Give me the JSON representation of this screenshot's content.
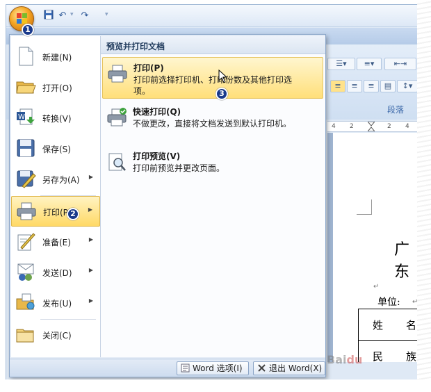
{
  "qat": {
    "undo_glyph": "↶",
    "redo_glyph": "↷",
    "more_glyph": "▾"
  },
  "ribbon": {
    "paragraph_group": "段落",
    "ruler_ticks": [
      "4",
      "2",
      "2",
      "4"
    ]
  },
  "document": {
    "title_fragment": "广东",
    "unit_label": "单位:",
    "table_cells": [
      "姓",
      "名",
      "民",
      "族"
    ],
    "return_mark": "↵"
  },
  "menu": {
    "left_items": [
      {
        "label": "新建(N)",
        "has_arrow": false
      },
      {
        "label": "打开(O)",
        "has_arrow": false
      },
      {
        "label": "转换(V)",
        "has_arrow": false
      },
      {
        "label": "保存(S)",
        "has_arrow": false
      },
      {
        "label": "另存为(A)",
        "has_arrow": true
      },
      {
        "label": "打印(P)",
        "has_arrow": true,
        "active": true
      },
      {
        "label": "准备(E)",
        "has_arrow": true
      },
      {
        "label": "发送(D)",
        "has_arrow": true
      },
      {
        "label": "发布(U)",
        "has_arrow": true
      },
      {
        "label": "关闭(C)",
        "has_arrow": false
      }
    ],
    "right_header": "预览并打印文档",
    "right_items": [
      {
        "title": "打印(P)",
        "desc": "打印前选择打印机、打印份数及其他打印选项。",
        "active": true
      },
      {
        "title": "快速打印(Q)",
        "desc": "不做更改，直接将文档发送到默认打印机。"
      },
      {
        "title": "打印预览(V)",
        "desc": "打印前预览并更改页面。"
      }
    ],
    "footer": {
      "options_label": "Word 选项(I)",
      "exit_label": "退出 Word(X)"
    }
  },
  "badges": [
    "1",
    "2",
    "3"
  ],
  "colors": {
    "accent": "#1a3a8c",
    "highlight": "#ffd966",
    "frame": "#dfe9f5"
  }
}
